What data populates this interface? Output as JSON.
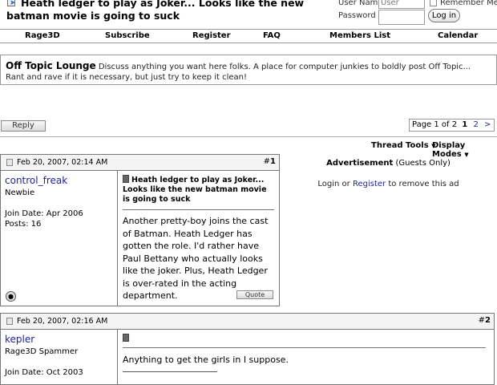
{
  "thread": {
    "title": "Heath ledger to play as Joker... Looks like the new batman movie is going to suck"
  },
  "login": {
    "username_label": "User Name",
    "username_value": "User Name",
    "remember_label": "Remember Me?",
    "password_label": "Password",
    "login_button": "Log in"
  },
  "navbar": {
    "items": [
      "Rage3D",
      "Subscribe",
      "Register",
      "FAQ",
      "Members List",
      "Calendar"
    ]
  },
  "forum": {
    "name": "Off Topic Lounge",
    "description": "Discuss anything you want here folks. A place for computer junkies to boldly post Off Topic... Rant and rave if it is necessary, but just try to keep it clean!"
  },
  "controls": {
    "reply_button": "Reply",
    "page_label": "Page 1 of 2",
    "pages": [
      "1",
      "2"
    ],
    "next": ">",
    "thread_tools": "Thread Tools",
    "display_modes": "Display Modes"
  },
  "posts": [
    {
      "date": "Feb 20, 2007, 02:14 AM",
      "hash": "#",
      "number": "1",
      "username": "control_freak",
      "rank": "Newbie",
      "join_date": "Join Date: Apr 2006",
      "posts": "Posts: 16",
      "title": "Heath ledger to play as Joker... Looks like the new batman movie is going to suck",
      "body": "Another pretty-boy joins the cast of Batman. Heath Ledger has gotten the role. I'd rather have Paul Bettany who actually looks like the joker. Plus, Heath Ledger is over-rated in the acting department.",
      "quote_button": "Quote"
    },
    {
      "date": "Feb 20, 2007, 02:16 AM",
      "hash": "#",
      "number": "2",
      "username": "kepler",
      "rank": "Rage3D Spammer",
      "join_date": "Join Date: Oct 2003",
      "title": "",
      "body": "Anything to get the girls in I suppose."
    }
  ],
  "ad": {
    "title": "Advertisement",
    "title_suffix": "(Guests Only)",
    "text_prefix": "Login or",
    "text_link": "Register",
    "text_suffix": "to remove this ad"
  },
  "colors": {
    "link": "#22229c",
    "border": "#777777"
  }
}
